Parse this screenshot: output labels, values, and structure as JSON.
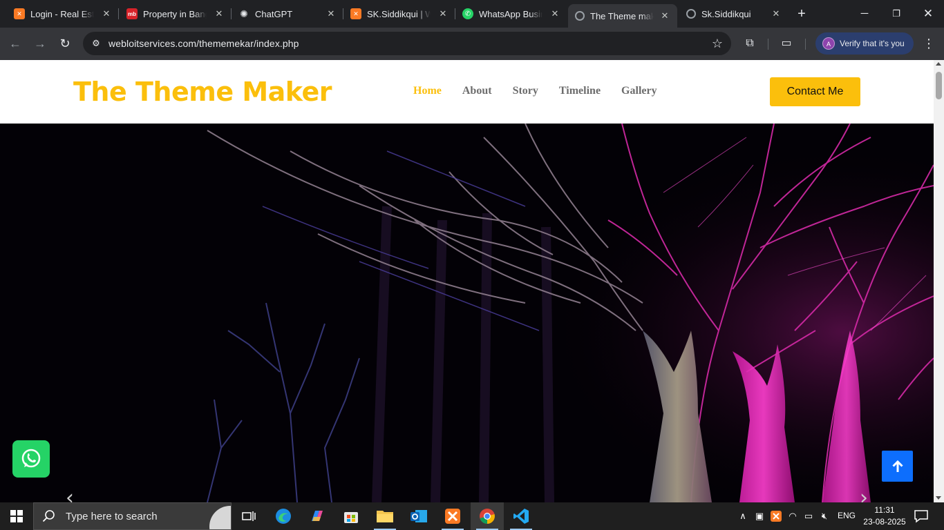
{
  "browser": {
    "tabs": [
      {
        "title": "Login - Real Estate",
        "icon": "xampp-icon",
        "active": false
      },
      {
        "title": "Property in Bangalore",
        "icon": "magicbricks-icon",
        "active": false
      },
      {
        "title": "ChatGPT",
        "icon": "chatgpt-icon",
        "active": false
      },
      {
        "title": "SK.Siddikqui | Web",
        "icon": "xampp-icon",
        "active": false
      },
      {
        "title": "WhatsApp Business",
        "icon": "whatsapp-icon",
        "active": false
      },
      {
        "title": "The Theme maker",
        "icon": "globe-icon",
        "active": true
      },
      {
        "title": "Sk.Siddikqui",
        "icon": "globe-icon",
        "active": false
      }
    ],
    "url": "webloitservices.com/thememekar/index.php",
    "verify_label": "Verify that it's you",
    "profile_initial": "A"
  },
  "site": {
    "brand": "The Theme Maker",
    "nav": [
      {
        "label": "Home",
        "active": true
      },
      {
        "label": "About",
        "active": false
      },
      {
        "label": "Story",
        "active": false
      },
      {
        "label": "Timeline",
        "active": false
      },
      {
        "label": "Gallery",
        "active": false
      }
    ],
    "contact_label": "Contact Me",
    "accent_color": "#fbbf0c",
    "whatsapp_color": "#25d366",
    "to_top_color": "#0d6efd"
  },
  "taskbar": {
    "search_placeholder": "Type here to search",
    "language": "ENG",
    "time": "11:31",
    "date": "23-08-2025"
  }
}
